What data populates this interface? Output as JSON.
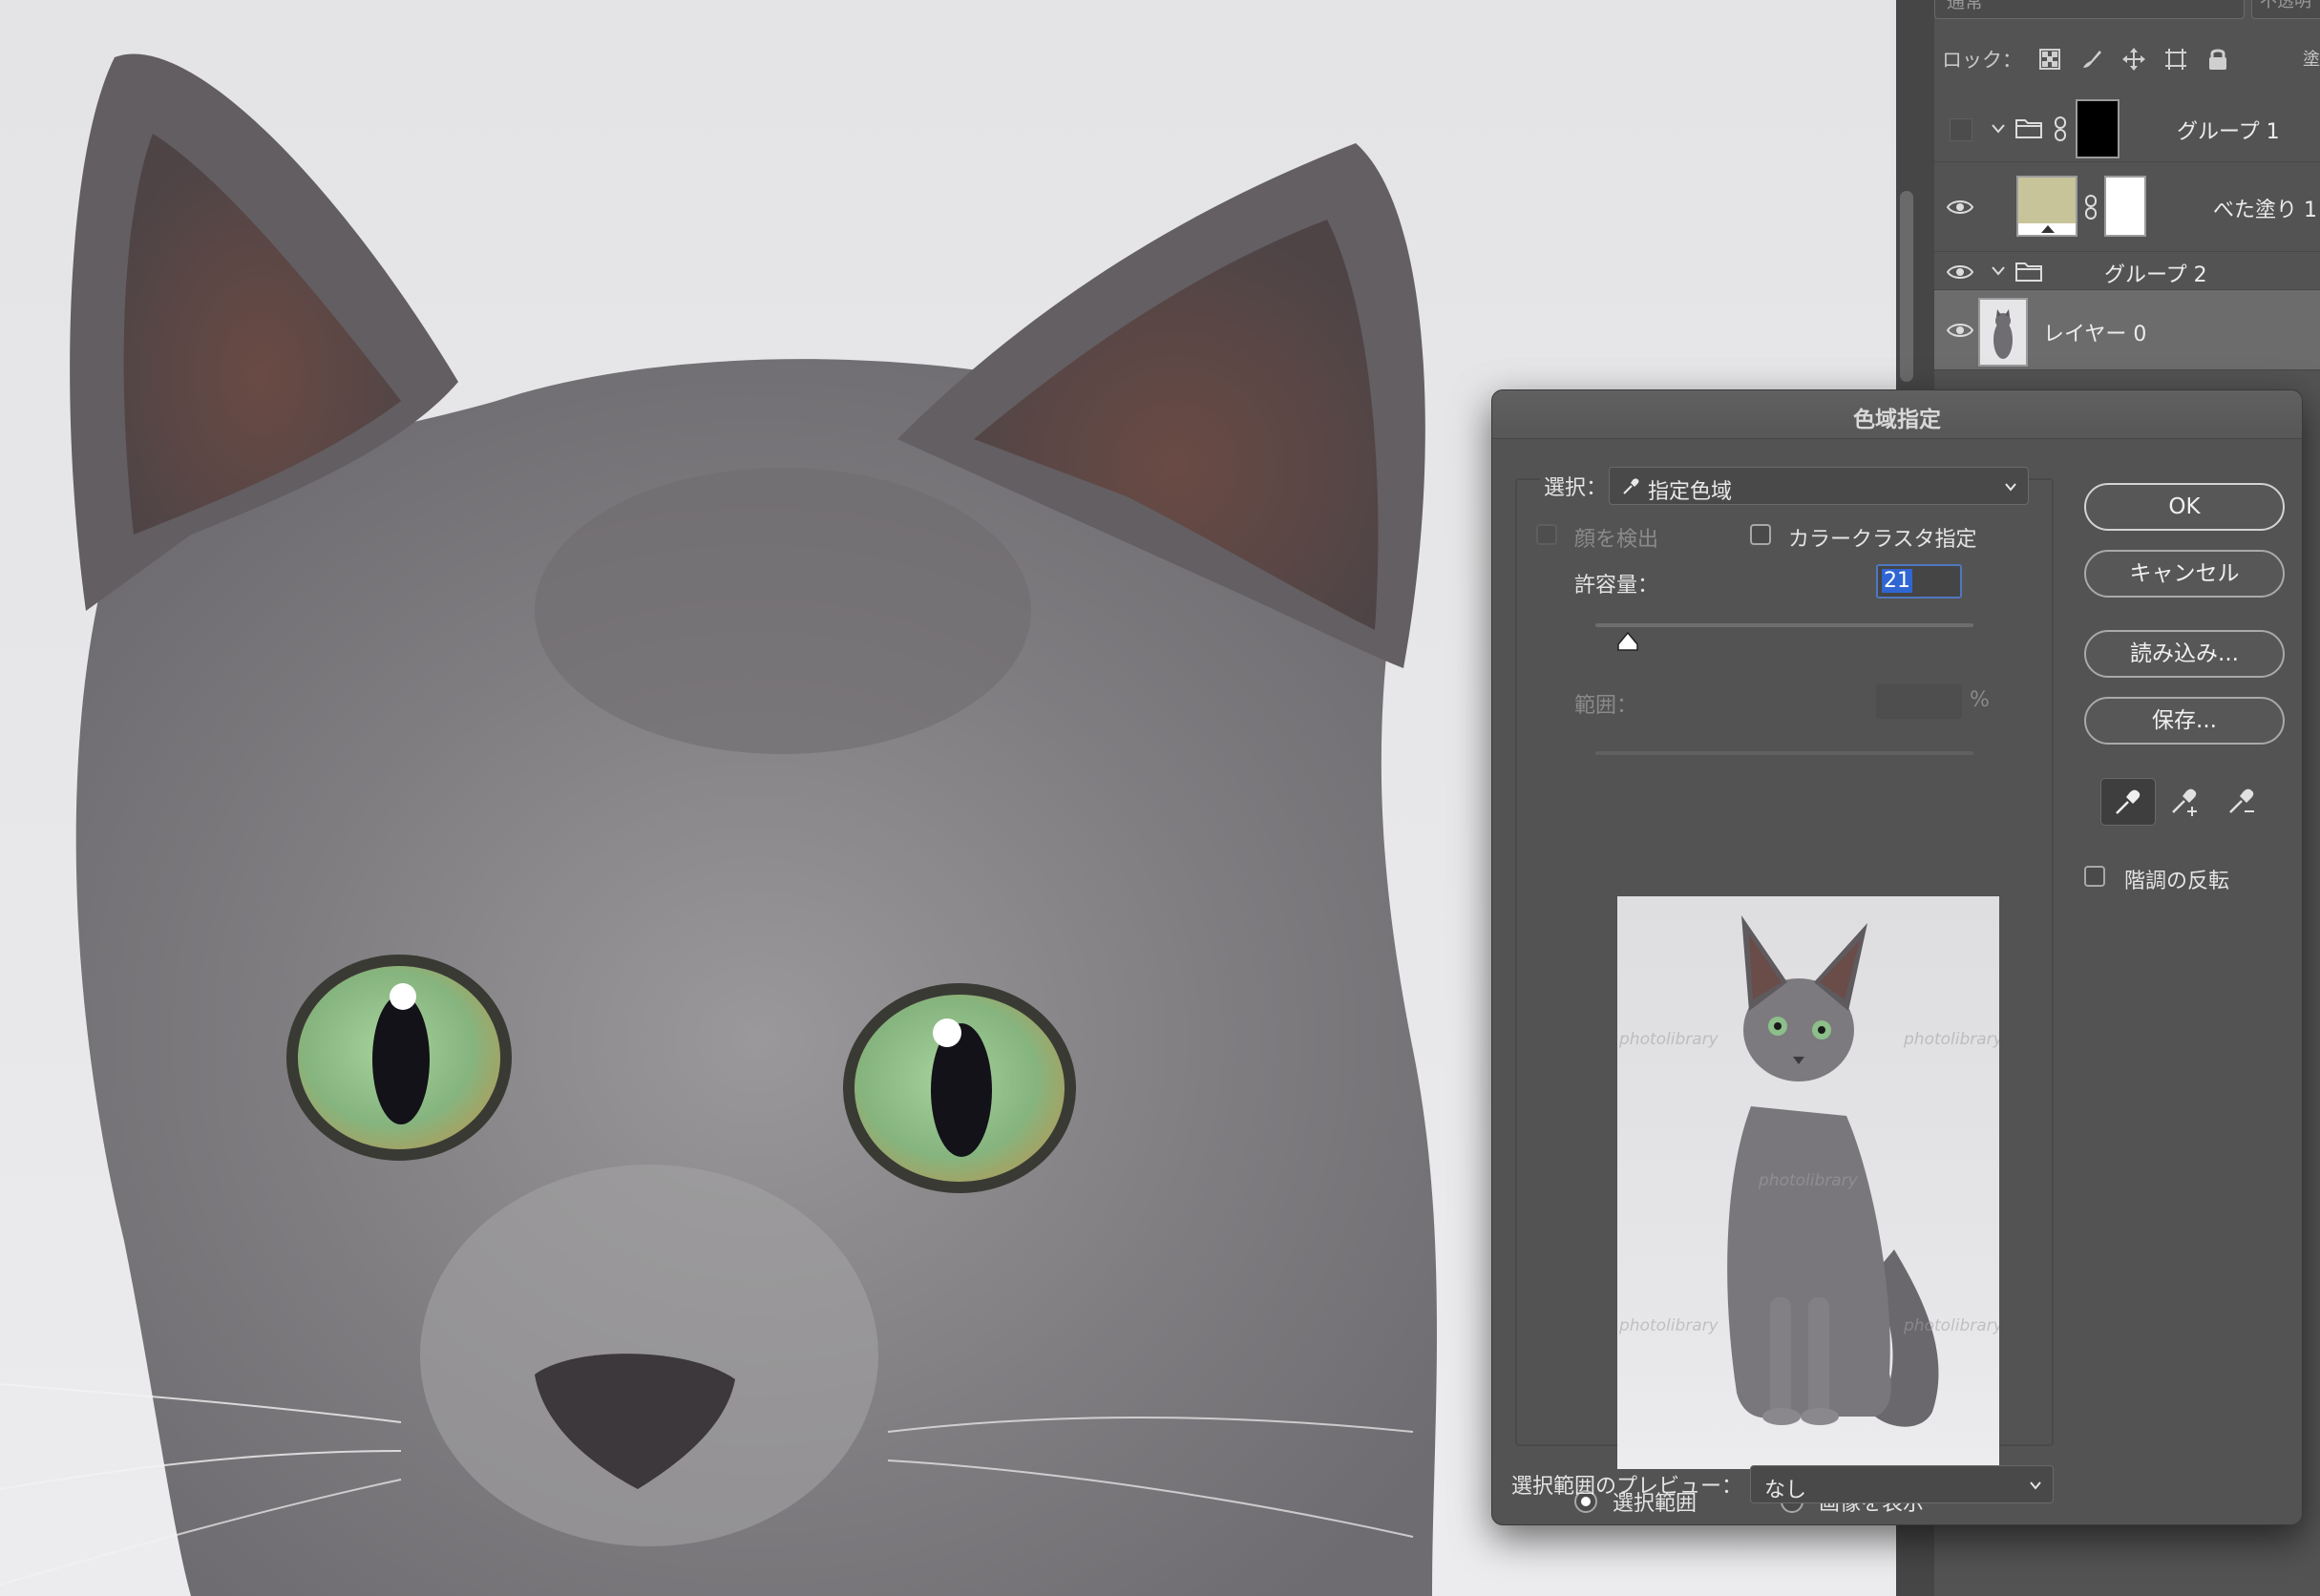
{
  "layers_panel": {
    "blend_mode": "通常",
    "opacity_label": "不透明",
    "lock_label": "ロック：",
    "fill_label": "塗",
    "layers": [
      {
        "name": "グループ 1",
        "type": "group",
        "visible": false,
        "expanded": true
      },
      {
        "name": "べた塗り 1",
        "type": "fill",
        "visible": true,
        "fill_color": "#c7c49a"
      },
      {
        "name": "グループ 2",
        "type": "group",
        "visible": true,
        "expanded": true
      },
      {
        "name": "レイヤー 0",
        "type": "image",
        "visible": true,
        "selected": true
      }
    ]
  },
  "dialog": {
    "title": "色域指定",
    "select_label": "選択：",
    "select_value": "指定色域",
    "detect_faces_label": "顔を検出",
    "localized_clusters_label": "カラークラスタ指定",
    "fuzziness_label": "許容量：",
    "fuzziness_value": "21",
    "range_label": "範囲：",
    "range_unit": "%",
    "radio_selection_label": "選択範囲",
    "radio_image_label": "画像を表示",
    "selection_preview_label": "選択範囲のプレビュー：",
    "selection_preview_value": "なし",
    "invert_label": "階調の反転",
    "buttons": {
      "ok": "OK",
      "cancel": "キャンセル",
      "load": "読み込み...",
      "save": "保存..."
    },
    "watermark": "photolibrary"
  },
  "colors": {
    "panel_bg": "#535353",
    "selection_highlight": "#2f66d3",
    "fill_swatch": "#c7c49a",
    "cat_fur": "#7d7b7d",
    "cat_eye": "#8cbf8a"
  }
}
